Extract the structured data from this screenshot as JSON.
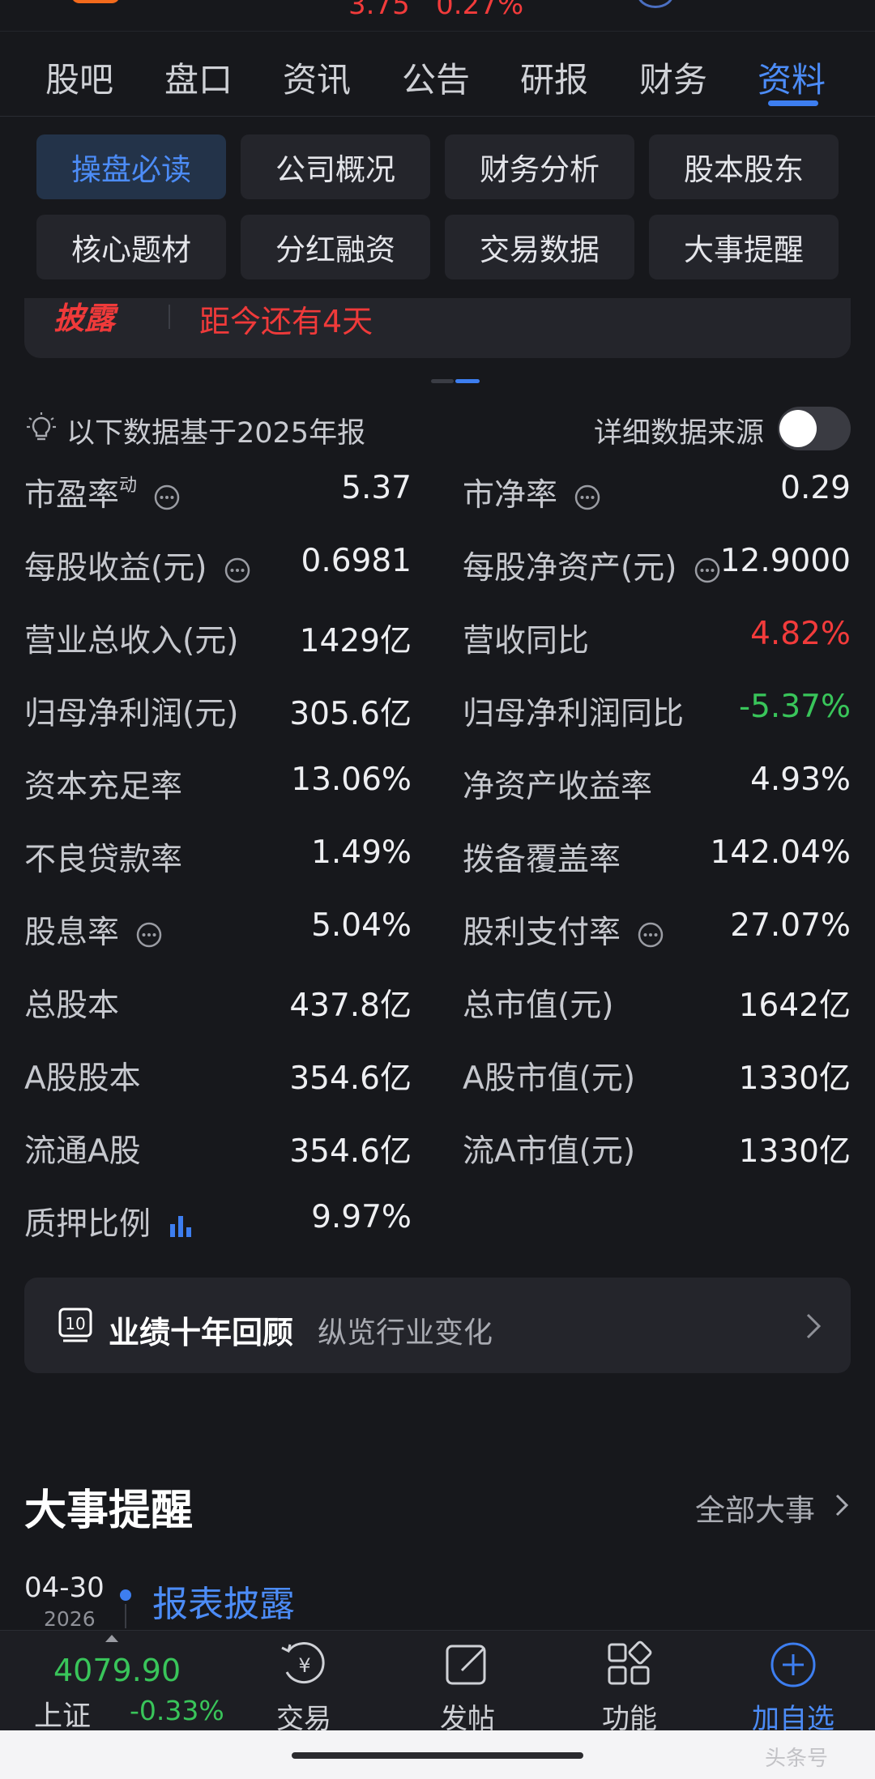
{
  "header": {
    "price_partial": "3.75   0.27%"
  },
  "main_tabs": [
    "股吧",
    "盘口",
    "资讯",
    "公告",
    "研报",
    "财务",
    "资料"
  ],
  "sub_tabs": [
    "操盘必读",
    "公司概况",
    "财务分析",
    "股本股东",
    "核心题材",
    "分红融资",
    "交易数据",
    "大事提醒"
  ],
  "disclosure": {
    "tag": "披露",
    "text": "距今还有4天"
  },
  "note": {
    "text": "以下数据基于2025年报",
    "source_label": "详细数据来源"
  },
  "metrics": [
    {
      "label": "市盈率",
      "sup": "动",
      "value": "5.37"
    },
    {
      "label": "市净率",
      "value": "0.29"
    },
    {
      "label": "每股收益(元)",
      "value": "0.6981"
    },
    {
      "label": "每股净资产(元)",
      "value": "12.9000"
    },
    {
      "label": "营业总收入(元)",
      "value": "1429亿"
    },
    {
      "label": "营收同比",
      "value": "4.82%"
    },
    {
      "label": "归母净利润(元)",
      "value": "305.6亿"
    },
    {
      "label": "归母净利润同比",
      "value": "-5.37%"
    },
    {
      "label": "资本充足率",
      "value": "13.06%"
    },
    {
      "label": "净资产收益率",
      "value": "4.93%"
    },
    {
      "label": "不良贷款率",
      "value": "1.49%"
    },
    {
      "label": "拨备覆盖率",
      "value": "142.04%"
    },
    {
      "label": "股息率",
      "value": "5.04%"
    },
    {
      "label": "股利支付率",
      "value": "27.07%"
    },
    {
      "label": "总股本",
      "value": "437.8亿"
    },
    {
      "label": "总市值(元)",
      "value": "1642亿"
    },
    {
      "label": "A股股本",
      "value": "354.6亿"
    },
    {
      "label": "A股市值(元)",
      "value": "1330亿"
    },
    {
      "label": "流通A股",
      "value": "354.6亿"
    },
    {
      "label": "流A市值(元)",
      "value": "1330亿"
    },
    {
      "label": "质押比例",
      "value": "9.97%"
    }
  ],
  "performance": {
    "icon_text": "10",
    "title": "业绩十年回顾",
    "subtitle": "纵览行业变化"
  },
  "events": {
    "title": "大事提醒",
    "all_label": "全部大事",
    "item": {
      "date": "04-30",
      "year": "2026",
      "title": "报表披露"
    }
  },
  "index": {
    "value": "4079.90",
    "name": "上证",
    "change": "-0.33%"
  },
  "bottom_nav": [
    "交易",
    "发帖",
    "功能",
    "加自选"
  ],
  "watermark": "头条号",
  "colors": {
    "accent": "#4c8cf7",
    "up": "#f23b3b",
    "down": "#39c55a",
    "background": "#17181c"
  }
}
